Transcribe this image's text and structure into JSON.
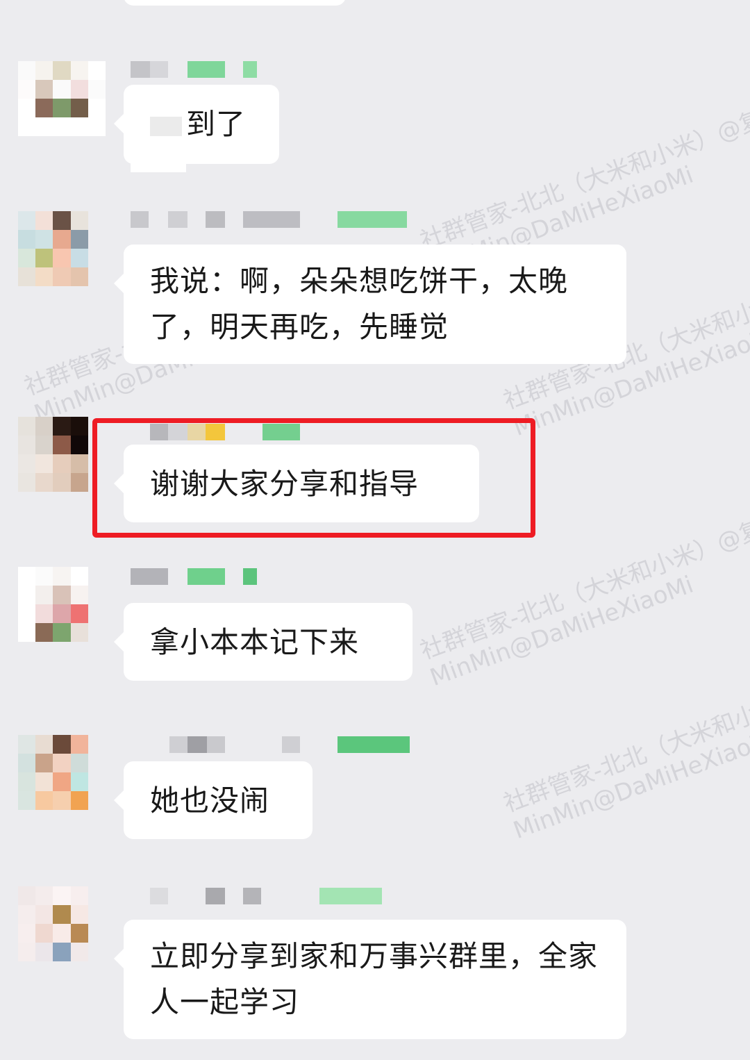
{
  "watermark": {
    "line1": "社群管家-北北（大米和小米）@复",
    "line2": "MinMin@DaMiHeXiaoMi"
  },
  "messages": [
    {
      "text": "到了"
    },
    {
      "text": "我说：啊，朵朵想吃饼干，太晚了，明天再吃，先睡觉"
    },
    {
      "text": "谢谢大家分享和指导",
      "highlighted": true
    },
    {
      "text": "拿小本本记下来"
    },
    {
      "text": "她也没闹"
    },
    {
      "text": "立即分享到家和万事兴群里，全家人一起学习"
    }
  ],
  "colors": {
    "background": "#ececef",
    "bubble": "#ffffff",
    "highlight_border": "#ee1c24",
    "name_green": "#7fd69a"
  }
}
